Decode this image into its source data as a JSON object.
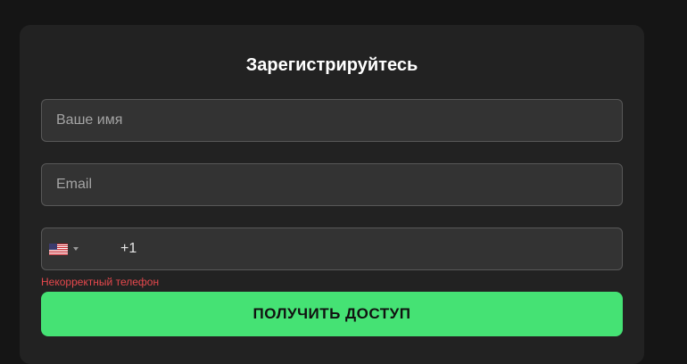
{
  "form": {
    "title": "Зарегистрируйтесь",
    "name_placeholder": "Ваше имя",
    "email_placeholder": "Email",
    "phone": {
      "country_flag": "us-flag-icon",
      "dial_code": "+1"
    },
    "error_text": "Некорректный телефон",
    "submit_label": "ПОЛУЧИТЬ ДОСТУП"
  },
  "colors": {
    "background": "#151515",
    "card": "#222222",
    "field": "#333333",
    "accent": "#45e274",
    "error": "#e5484d"
  }
}
